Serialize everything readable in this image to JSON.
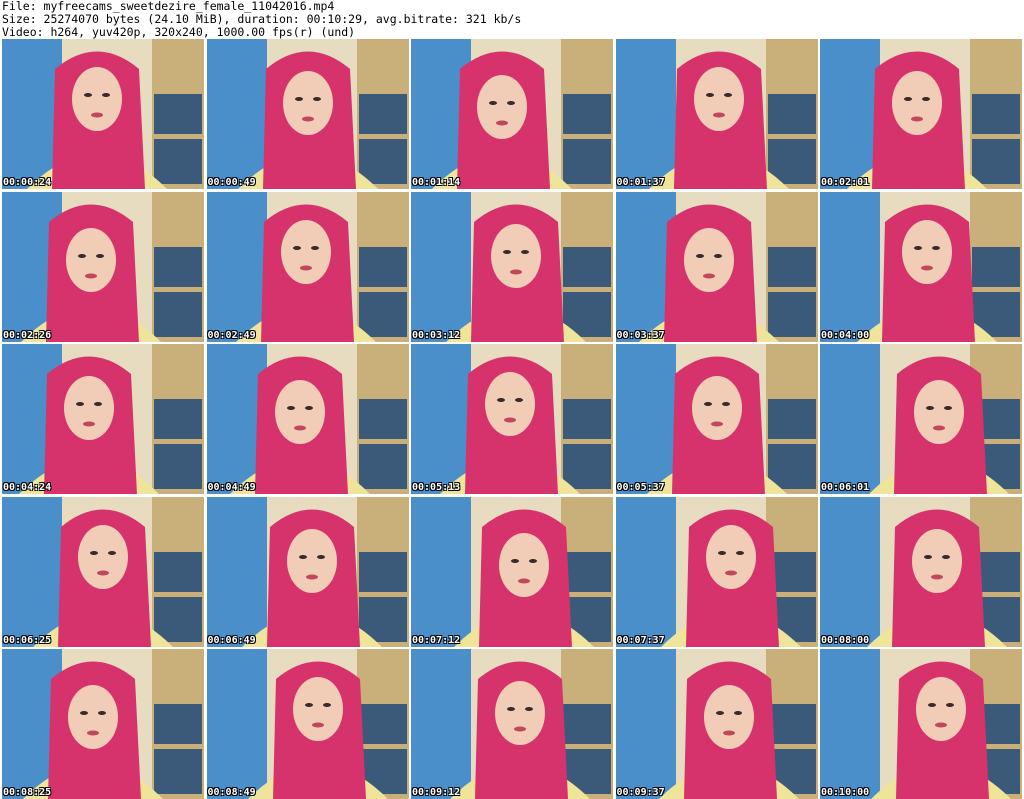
{
  "header": {
    "line1": "File: myfreecams_sweetdezire_female_11042016.mp4",
    "line2": "Size: 25274070 bytes (24.10 MiB), duration: 00:10:29, avg.bitrate: 321 kb/s",
    "line3": "Video: h264, yuv420p, 320x240, 1000.00 fps(r) (und)"
  },
  "thumbnails": [
    {
      "time": "00:00:24"
    },
    {
      "time": "00:00:49"
    },
    {
      "time": "00:01:14"
    },
    {
      "time": "00:01:37"
    },
    {
      "time": "00:02:01"
    },
    {
      "time": "00:02:26"
    },
    {
      "time": "00:02:49"
    },
    {
      "time": "00:03:12"
    },
    {
      "time": "00:03:37"
    },
    {
      "time": "00:04:00"
    },
    {
      "time": "00:04:24"
    },
    {
      "time": "00:04:49"
    },
    {
      "time": "00:05:13"
    },
    {
      "time": "00:05:37"
    },
    {
      "time": "00:06:01"
    },
    {
      "time": "00:06:25"
    },
    {
      "time": "00:06:49"
    },
    {
      "time": "00:07:12"
    },
    {
      "time": "00:07:37"
    },
    {
      "time": "00:08:00"
    },
    {
      "time": "00:08:25"
    },
    {
      "time": "00:08:49"
    },
    {
      "time": "00:09:12"
    },
    {
      "time": "00:09:37"
    },
    {
      "time": "00:10:00"
    }
  ],
  "colors": {
    "hair": "#d6336c",
    "shirt": "#eee59a",
    "skin": "#f1cdb8",
    "wall": "#4a8fc9",
    "shelf": "#c9b07a",
    "cabinet": "#3b5a7a"
  }
}
